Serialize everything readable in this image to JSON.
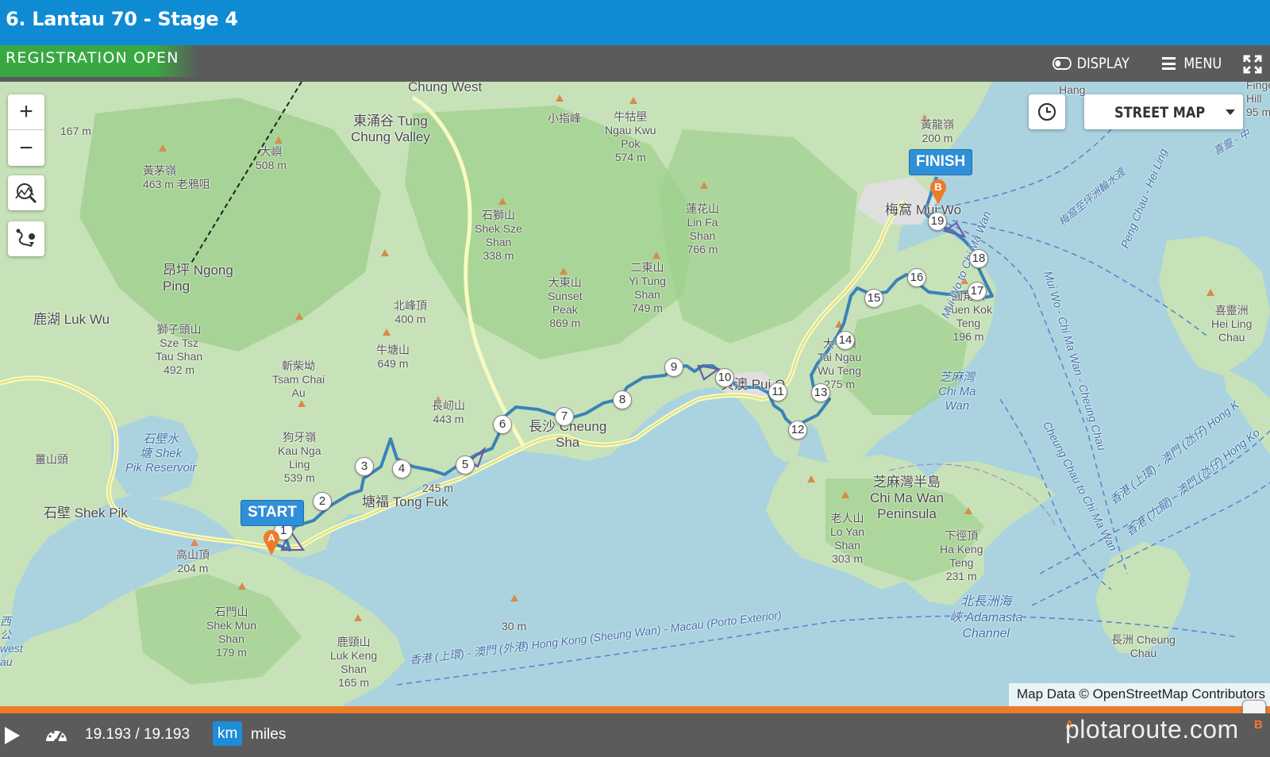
{
  "header": {
    "title": "6. Lantau 70 - Stage 4"
  },
  "toolbar": {
    "registration": "REGISTRATION OPEN",
    "display_label": "DISPLAY",
    "menu_label": "MENU",
    "expand_icon": "expand-icon"
  },
  "map": {
    "controls": {
      "zoom_in": "+",
      "zoom_out": "−",
      "icons": [
        "elevation-profile-icon",
        "route-directions-icon",
        "clock-icon"
      ]
    },
    "layer_select": "STREET MAP",
    "start_label": "START",
    "finish_label": "FINISH",
    "marker_a": "A",
    "marker_b": "B",
    "waypoints": [
      "1",
      "2",
      "3",
      "4",
      "5",
      "6",
      "7",
      "8",
      "9",
      "10",
      "11",
      "12",
      "13",
      "14",
      "15",
      "16",
      "17",
      "18",
      "19"
    ],
    "attribution": "Map Data © OpenStreetMap Contributors",
    "route_color": "#3b82b8",
    "places": [
      {
        "id": "chung-west",
        "text": "Chung West"
      },
      {
        "id": "tung-chung-valley",
        "text": "東涌谷 Tung\nChung Valley"
      },
      {
        "id": "ngong-ping",
        "text": "昂坪 Ngong\nPing"
      },
      {
        "id": "luk-wu",
        "text": "鹿湖 Luk Wu"
      },
      {
        "id": "sze-tsz",
        "text": "獅子頭山\nSze Tsz\nTau Shan\n492 m"
      },
      {
        "id": "tsam-chai",
        "text": "斬柴坳\nTsam Chai\nAu"
      },
      {
        "id": "kau-nga",
        "text": "狗牙嶺\nKau Nga\nLing\n539 m"
      },
      {
        "id": "shek-pik",
        "text": "石壁 Shek Pik"
      },
      {
        "id": "shek-pik-reservoir",
        "text": "石壁水\n塘 Shek\nPik Reservoir"
      },
      {
        "id": "tong-fuk",
        "text": "塘福 Tong Fuk"
      },
      {
        "id": "cheung-sha",
        "text": "長沙 Cheung\nSha"
      },
      {
        "id": "pui-o",
        "text": "貝澳 Pui O"
      },
      {
        "id": "mui-wo",
        "text": "梅窩 Mui Wo"
      },
      {
        "id": "chi-ma-wan",
        "text": "芝麻灣半島\nChi Ma Wan\nPeninsula"
      },
      {
        "id": "sunset-peak",
        "text": "大東山\nSunset\nPeak\n869 m"
      },
      {
        "id": "lin-fa",
        "text": "蓮花山\nLin Fa\nShan\n766 m"
      },
      {
        "id": "yi-tung",
        "text": "二東山\nYi Tung\nShan\n749 m"
      },
      {
        "id": "shek-sze",
        "text": "石獅山\nShek Sze\nShan\n338 m"
      },
      {
        "id": "ngau-kwu",
        "text": "牛牯壆\nNgau Kwu\nPok\n574 m"
      },
      {
        "id": "siu-chi",
        "text": "小指峰"
      },
      {
        "id": "pak-fung",
        "text": "北峰頂\n400 m"
      },
      {
        "id": "ngau-tong",
        "text": "牛塘山\n649 m"
      },
      {
        "id": "cheung-kwat",
        "text": "長屻山\n443 m"
      },
      {
        "id": "tai-yue",
        "text": "大嶼\n508 m"
      },
      {
        "id": "wong-mau",
        "text": "黃茅嶺\n463 m 老鴉咀"
      },
      {
        "id": "m167",
        "text": "167 m"
      },
      {
        "id": "wong-lung",
        "text": "黃龍嶺\n200 m"
      },
      {
        "id": "yuen-kok",
        "text": "圓角頂\nYuen Kok\nTeng\n196 m"
      },
      {
        "id": "tai-ngau",
        "text": "大牛頂\nTai Ngau\nWu Teng\n275 m"
      },
      {
        "id": "lo-yan",
        "text": "老人山\nLo Yan\nShan\n303 m"
      },
      {
        "id": "ha-keng",
        "text": "下徑頂\nHa Keng\nTeng\n231 m"
      },
      {
        "id": "ko-shan",
        "text": "高山頂\n204 m"
      },
      {
        "id": "shek-mun",
        "text": "石門山\nShek Mun\nShan\n179 m"
      },
      {
        "id": "luk-keng",
        "text": "鹿頸山\nLuk Keng\nShan\n165 m"
      },
      {
        "id": "wong-shan",
        "text": "薑山頭"
      },
      {
        "id": "m245",
        "text": "245 m"
      },
      {
        "id": "m30",
        "text": "30 m"
      },
      {
        "id": "hei-ling",
        "text": "喜靈洲\nHei Ling\nChau"
      },
      {
        "id": "cheung-chau",
        "text": "長洲 Cheung\nChau"
      },
      {
        "id": "hang",
        "text": "Hang"
      },
      {
        "id": "finge-hill",
        "text": "Finge\nHill\n95 m"
      }
    ],
    "water_labels": [
      {
        "id": "chi-ma-wan-bay",
        "text": "芝麻灣\nChi Ma\nWan"
      },
      {
        "id": "adamasta",
        "text": "北長洲海\n峽 Adamasta\nChannel"
      },
      {
        "id": "ferry-hk-macau",
        "text": "香港 (上環) - 澳門 (外港) Hong Kong (Sheung Wan) - Macau (Porto Exterior)"
      },
      {
        "id": "mui-wo-chi-ma-wan",
        "text": "Mui Wo to Chi Ma Wan"
      },
      {
        "id": "mui-wo-cheung-chau",
        "text": "Mui Wo - Chi Ma Wan - Cheung Chau"
      },
      {
        "id": "cheung-chau-chi-ma-wan",
        "text": "Cheung Chau to Chi Ma Wan"
      },
      {
        "id": "peng-chau",
        "text": "Peng Chau - Hei Ling"
      },
      {
        "id": "mui-wo-peng-chau",
        "text": "梅窩至坪洲輪水渡"
      },
      {
        "id": "hk-macau-2",
        "text": "香港 (上環) - 澳門 (氹仔) Hong K"
      },
      {
        "id": "hk-macau-3",
        "text": "香港 (九龍) - 澳門 (氹仔) Hong Ko"
      },
      {
        "id": "hei-ling-chau-ch",
        "text": "喜靈 - 中"
      },
      {
        "id": "west",
        "text": "西\n公\nwest\nau"
      }
    ]
  },
  "footer": {
    "distance": "19.193 / 19.193",
    "unit_km": "km",
    "unit_miles": "miles",
    "brand": "plotaroute.com",
    "brand_marks": [
      "A",
      "B"
    ]
  }
}
